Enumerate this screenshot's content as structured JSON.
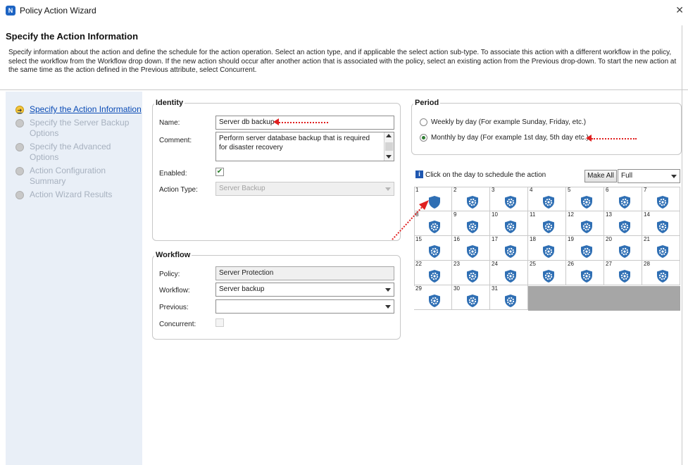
{
  "window": {
    "title": "Policy Action Wizard",
    "close_glyph": "✕",
    "app_icon": "networker-shield-icon"
  },
  "header": {
    "title": "Specify the Action Information",
    "description": "Specify information about the action and define the schedule for the action operation. Select an action type, and if applicable the select action sub-type. To associate this action with a different workflow in the policy, select the workflow from the Workflow drop down. If the new action should occur after another action that is associated with the policy, select an existing action from the Previous drop-down. To start the new action at the same time as the action defined in the Previous attribute, select Concurrent."
  },
  "nav": {
    "items": [
      {
        "label": "Specify the Action Information",
        "active": true
      },
      {
        "label": "Specify the Server Backup Options",
        "active": false
      },
      {
        "label": "Specify the Advanced Options",
        "active": false
      },
      {
        "label": "Action Configuration Summary",
        "active": false
      },
      {
        "label": "Action Wizard Results",
        "active": false
      }
    ]
  },
  "identity": {
    "title": "Identity",
    "name_label": "Name:",
    "name_value": "Server db backup",
    "comment_label": "Comment:",
    "comment_value": "Perform server database backup that is required for disaster recovery",
    "enabled_label": "Enabled:",
    "enabled_checked": true,
    "action_type_label": "Action Type:",
    "action_type_value": "Server Backup"
  },
  "workflow": {
    "title": "Workflow",
    "policy_label": "Policy:",
    "policy_value": "Server Protection",
    "workflow_label": "Workflow:",
    "workflow_value": "Server backup",
    "previous_label": "Previous:",
    "previous_value": "",
    "concurrent_label": "Concurrent:",
    "concurrent_checked": false
  },
  "period": {
    "title": "Period",
    "weekly_label": "Weekly by day  (For example Sunday, Friday, etc.)",
    "monthly_label": "Monthly by day (For example 1st day, 5th day etc.)",
    "selected": "monthly"
  },
  "calendar": {
    "caption": "Click on the day to schedule the action",
    "make_all_label": "Make All",
    "level_value": "Full",
    "days": [
      "1",
      "2",
      "3",
      "4",
      "5",
      "6",
      "7",
      "8",
      "9",
      "10",
      "11",
      "12",
      "13",
      "14",
      "15",
      "16",
      "17",
      "18",
      "19",
      "20",
      "21",
      "22",
      "23",
      "24",
      "25",
      "26",
      "27",
      "28",
      "29",
      "30",
      "31"
    ],
    "day1_icon": "full-backup-shield-icon",
    "other_icon": "gear-shield-icon",
    "colors": {
      "shield": "#2f6fb4",
      "accent": "#1f57b0",
      "arrow": "#e02020"
    }
  }
}
